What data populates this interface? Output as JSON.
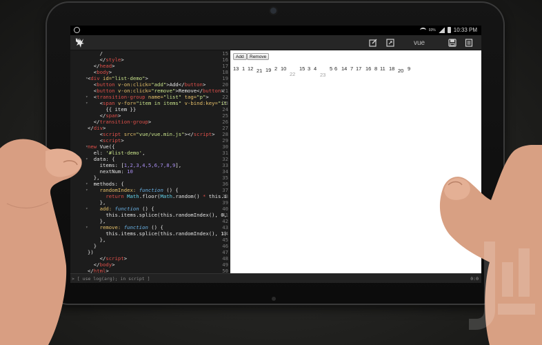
{
  "status_bar": {
    "time": "10:33 PM",
    "battery": "93%"
  },
  "toolbar": {
    "title": "vue"
  },
  "editor": {
    "lines": [
      {
        "n": "15",
        "fold": "",
        "segs": [
          {
            "t": "    ",
            "c": "plain"
          },
          {
            "t": "/",
            "c": "plain"
          }
        ]
      },
      {
        "n": "16",
        "fold": "",
        "segs": [
          {
            "t": "    </",
            "c": "plain"
          },
          {
            "t": "style",
            "c": "tag"
          },
          {
            "t": ">",
            "c": "plain"
          }
        ]
      },
      {
        "n": "17",
        "fold": "",
        "segs": [
          {
            "t": "  </",
            "c": "plain"
          },
          {
            "t": "head",
            "c": "tag"
          },
          {
            "t": ">",
            "c": "plain"
          }
        ]
      },
      {
        "n": "18",
        "fold": "",
        "segs": [
          {
            "t": "  <",
            "c": "plain"
          },
          {
            "t": "body",
            "c": "tag"
          },
          {
            "t": ">",
            "c": "plain"
          }
        ]
      },
      {
        "n": "19",
        "fold": "▾",
        "segs": [
          {
            "t": "<",
            "c": "plain"
          },
          {
            "t": "div",
            "c": "tag"
          },
          {
            "t": " id=",
            "c": "atr"
          },
          {
            "t": "\"list-demo\"",
            "c": "str"
          },
          {
            "t": ">",
            "c": "plain"
          }
        ]
      },
      {
        "n": "20",
        "fold": "",
        "segs": [
          {
            "t": "  <",
            "c": "plain"
          },
          {
            "t": "button",
            "c": "tag"
          },
          {
            "t": " v-on:click=",
            "c": "atr"
          },
          {
            "t": "\"add\"",
            "c": "str"
          },
          {
            "t": ">Add</",
            "c": "plain"
          },
          {
            "t": "button",
            "c": "tag"
          },
          {
            "t": ">",
            "c": "plain"
          }
        ]
      },
      {
        "n": "21",
        "fold": "",
        "segs": [
          {
            "t": "  <",
            "c": "plain"
          },
          {
            "t": "button",
            "c": "tag"
          },
          {
            "t": " v-on:click=",
            "c": "atr"
          },
          {
            "t": "\"remove\"",
            "c": "str"
          },
          {
            "t": ">Remove</",
            "c": "plain"
          },
          {
            "t": "button",
            "c": "tag"
          },
          {
            "t": ">",
            "c": "plain"
          }
        ]
      },
      {
        "n": "22",
        "fold": "▾",
        "segs": [
          {
            "t": "  <",
            "c": "plain"
          },
          {
            "t": "transition-group",
            "c": "tag"
          },
          {
            "t": " name=",
            "c": "atr"
          },
          {
            "t": "\"list\"",
            "c": "str"
          },
          {
            "t": " tag=",
            "c": "atr"
          },
          {
            "t": "\"p\"",
            "c": "str"
          },
          {
            "t": ">",
            "c": "plain"
          }
        ]
      },
      {
        "n": "23",
        "fold": "▾",
        "segs": [
          {
            "t": "    <",
            "c": "plain"
          },
          {
            "t": "span",
            "c": "tag"
          },
          {
            "t": " v-for=",
            "c": "atr"
          },
          {
            "t": "\"item in items\"",
            "c": "str"
          },
          {
            "t": " v-bind:key=",
            "c": "atr"
          },
          {
            "t": "\"it",
            "c": "str"
          }
        ]
      },
      {
        "n": "24",
        "fold": "",
        "segs": [
          {
            "t": "      {{ item }}",
            "c": "plain"
          }
        ]
      },
      {
        "n": "25",
        "fold": "",
        "segs": [
          {
            "t": "    </",
            "c": "plain"
          },
          {
            "t": "span",
            "c": "tag"
          },
          {
            "t": ">",
            "c": "plain"
          }
        ]
      },
      {
        "n": "26",
        "fold": "",
        "segs": [
          {
            "t": "  </",
            "c": "plain"
          },
          {
            "t": "transition-group",
            "c": "tag"
          },
          {
            "t": ">",
            "c": "plain"
          }
        ]
      },
      {
        "n": "27",
        "fold": "",
        "segs": [
          {
            "t": "</",
            "c": "plain"
          },
          {
            "t": "div",
            "c": "tag"
          },
          {
            "t": ">",
            "c": "plain"
          }
        ]
      },
      {
        "n": "28",
        "fold": "",
        "segs": [
          {
            "t": "    <",
            "c": "plain"
          },
          {
            "t": "script",
            "c": "tag"
          },
          {
            "t": " src=",
            "c": "atr"
          },
          {
            "t": "\"vue/vue.min.js\"",
            "c": "str"
          },
          {
            "t": "></",
            "c": "plain"
          },
          {
            "t": "script",
            "c": "tag"
          },
          {
            "t": ">",
            "c": "plain"
          }
        ]
      },
      {
        "n": "29",
        "fold": "",
        "segs": [
          {
            "t": "    <",
            "c": "plain"
          },
          {
            "t": "script",
            "c": "tag"
          },
          {
            "t": ">",
            "c": "plain"
          }
        ]
      },
      {
        "n": "30",
        "fold": "▾",
        "segs": [
          {
            "t": "new ",
            "c": "tag"
          },
          {
            "t": "Vue({",
            "c": "plain"
          }
        ]
      },
      {
        "n": "31",
        "fold": "",
        "segs": [
          {
            "t": "  el: ",
            "c": "plain"
          },
          {
            "t": "'#list-demo'",
            "c": "str"
          },
          {
            "t": ",",
            "c": "plain"
          }
        ]
      },
      {
        "n": "32",
        "fold": "▾",
        "segs": [
          {
            "t": "  data: {",
            "c": "plain"
          }
        ]
      },
      {
        "n": "33",
        "fold": "",
        "segs": [
          {
            "t": "    items: [",
            "c": "plain"
          },
          {
            "t": "1,2,3,4,5,6,7,8,9",
            "c": "num"
          },
          {
            "t": "],",
            "c": "plain"
          }
        ]
      },
      {
        "n": "34",
        "fold": "",
        "segs": [
          {
            "t": "    nextNum: ",
            "c": "plain"
          },
          {
            "t": "10",
            "c": "num"
          }
        ]
      },
      {
        "n": "35",
        "fold": "",
        "segs": [
          {
            "t": "  },",
            "c": "plain"
          }
        ]
      },
      {
        "n": "36",
        "fold": "▾",
        "segs": [
          {
            "t": "  methods: {",
            "c": "plain"
          }
        ]
      },
      {
        "n": "37",
        "fold": "▾",
        "segs": [
          {
            "t": "    randomIndex: ",
            "c": "atr"
          },
          {
            "t": "function",
            "c": "fn"
          },
          {
            "t": " () {",
            "c": "plain"
          }
        ]
      },
      {
        "n": "38",
        "fold": "",
        "segs": [
          {
            "t": "      ",
            "c": "plain"
          },
          {
            "t": "return ",
            "c": "tag"
          },
          {
            "t": "Math",
            "c": "ty"
          },
          {
            "t": ".floor(",
            "c": "plain"
          },
          {
            "t": "Math",
            "c": "ty"
          },
          {
            "t": ".random() ",
            "c": "plain"
          },
          {
            "t": "* ",
            "c": "tag"
          },
          {
            "t": "this.i",
            "c": "plain"
          }
        ]
      },
      {
        "n": "39",
        "fold": "",
        "segs": [
          {
            "t": "    },",
            "c": "plain"
          }
        ]
      },
      {
        "n": "40",
        "fold": "▾",
        "segs": [
          {
            "t": "    add: ",
            "c": "atr"
          },
          {
            "t": "function",
            "c": "fn"
          },
          {
            "t": " () {",
            "c": "plain"
          }
        ]
      },
      {
        "n": "41",
        "fold": "",
        "segs": [
          {
            "t": "      this.items.splice(this.randomIndex(), 0,",
            "c": "plain"
          }
        ]
      },
      {
        "n": "42",
        "fold": "",
        "segs": [
          {
            "t": "    },",
            "c": "plain"
          }
        ]
      },
      {
        "n": "43",
        "fold": "▾",
        "segs": [
          {
            "t": "    remove: ",
            "c": "atr"
          },
          {
            "t": "function",
            "c": "fn"
          },
          {
            "t": " () {",
            "c": "plain"
          }
        ]
      },
      {
        "n": "44",
        "fold": "",
        "segs": [
          {
            "t": "      this.items.splice(this.randomIndex(), 1)",
            "c": "plain"
          }
        ]
      },
      {
        "n": "45",
        "fold": "",
        "segs": [
          {
            "t": "    },",
            "c": "plain"
          }
        ]
      },
      {
        "n": "46",
        "fold": "",
        "segs": [
          {
            "t": "  }",
            "c": "plain"
          }
        ]
      },
      {
        "n": "47",
        "fold": "",
        "segs": [
          {
            "t": "})",
            "c": "plain"
          }
        ]
      },
      {
        "n": "48",
        "fold": "",
        "segs": [
          {
            "t": "    </",
            "c": "plain"
          },
          {
            "t": "script",
            "c": "tag"
          },
          {
            "t": ">",
            "c": "plain"
          }
        ]
      },
      {
        "n": "49",
        "fold": "",
        "segs": [
          {
            "t": "  </",
            "c": "plain"
          },
          {
            "t": "body",
            "c": "tag"
          },
          {
            "t": ">",
            "c": "plain"
          }
        ]
      },
      {
        "n": "50",
        "fold": "",
        "segs": [
          {
            "t": "</",
            "c": "plain"
          },
          {
            "t": "html",
            "c": "tag"
          },
          {
            "t": ">",
            "c": "plain"
          }
        ]
      },
      {
        "n": "51",
        "fold": "",
        "segs": [
          {
            "t": "",
            "c": "plain"
          }
        ]
      }
    ]
  },
  "console": {
    "prompt": "> [ use log(arg); in script ]",
    "cursor": "0:0"
  },
  "preview": {
    "add_label": "Add",
    "remove_label": "Remove",
    "numbers": [
      {
        "v": "13",
        "gray": false
      },
      {
        "v": "1",
        "gray": false
      },
      {
        "v": "12",
        "gray": false
      },
      {
        "v": "21",
        "gray": false
      },
      {
        "v": "19",
        "gray": false
      },
      {
        "v": "2",
        "gray": false
      },
      {
        "v": "10",
        "gray": false
      },
      {
        "v": "22",
        "gray": true
      },
      {
        "v": "15",
        "gray": false
      },
      {
        "v": "3",
        "gray": false
      },
      {
        "v": "4",
        "gray": false
      },
      {
        "v": "23",
        "gray": true
      },
      {
        "v": "5",
        "gray": false
      },
      {
        "v": "6",
        "gray": false
      },
      {
        "v": "14",
        "gray": false
      },
      {
        "v": "7",
        "gray": false
      },
      {
        "v": "17",
        "gray": false
      },
      {
        "v": "16",
        "gray": false
      },
      {
        "v": "8",
        "gray": false
      },
      {
        "v": "11",
        "gray": false
      },
      {
        "v": "18",
        "gray": false
      },
      {
        "v": "20",
        "gray": false
      },
      {
        "v": "9",
        "gray": false
      }
    ]
  },
  "colors": {
    "editor_bg": "#1c1c1c",
    "toolbar_bg": "#262626",
    "tag": "#e0504a",
    "string": "#c9e38b",
    "attr": "#e8c26a",
    "number": "#a98ff1"
  }
}
